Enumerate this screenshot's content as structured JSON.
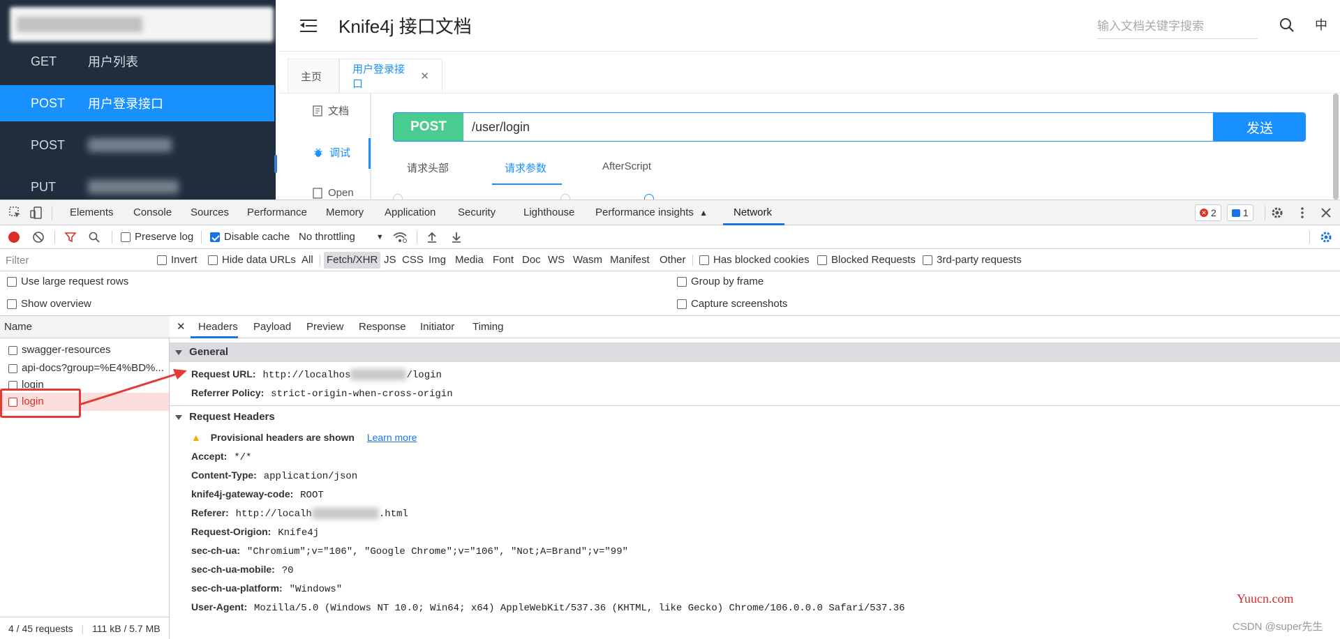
{
  "app": {
    "sidebar": {
      "items": [
        {
          "method": "GET",
          "label": "用户列表"
        },
        {
          "method": "POST",
          "label": "用户登录接口"
        },
        {
          "method": "POST",
          "label": ""
        },
        {
          "method": "PUT",
          "label": ""
        }
      ]
    },
    "header": {
      "title": "Knife4j 接口文档",
      "search_placeholder": "输入文档关键字搜索",
      "lang": "中"
    },
    "tabs": [
      {
        "label": "主页"
      },
      {
        "label": "用户登录接口"
      }
    ],
    "vnav": [
      {
        "label": "文档"
      },
      {
        "label": "调试"
      },
      {
        "label": "Open"
      }
    ],
    "request": {
      "method": "POST",
      "url": "/user/login",
      "send_label": "发送"
    },
    "req_tabs": [
      {
        "label": "请求头部"
      },
      {
        "label": "请求参数"
      },
      {
        "label": "AfterScript"
      }
    ]
  },
  "devtools": {
    "tabs": [
      "Elements",
      "Console",
      "Sources",
      "Performance",
      "Memory",
      "Application",
      "Security",
      "Lighthouse",
      "Performance insights",
      "Network"
    ],
    "active_tab": "Network",
    "error_count": "2",
    "message_count": "1",
    "toolbar": {
      "preserve_log": "Preserve log",
      "disable_cache": "Disable cache",
      "throttling": "No throttling"
    },
    "filter": {
      "placeholder": "Filter",
      "invert": "Invert",
      "hide_data_urls": "Hide data URLs",
      "types": [
        "All",
        "Fetch/XHR",
        "JS",
        "CSS",
        "Img",
        "Media",
        "Font",
        "Doc",
        "WS",
        "Wasm",
        "Manifest",
        "Other"
      ],
      "active_type": "Fetch/XHR",
      "has_blocked_cookies": "Has blocked cookies",
      "blocked_requests": "Blocked Requests",
      "third_party": "3rd-party requests"
    },
    "options": {
      "large_rows": "Use large request rows",
      "show_overview": "Show overview",
      "group_by_frame": "Group by frame",
      "capture_screenshots": "Capture screenshots"
    },
    "list": {
      "header": "Name",
      "rows": [
        "swagger-resources",
        "api-docs?group=%E4%BD%...",
        "login",
        "login"
      ],
      "selected_index": 3,
      "footer_requests": "4 / 45 requests",
      "footer_size": "111 kB / 5.7 MB"
    },
    "detail": {
      "tabs": [
        "Headers",
        "Payload",
        "Preview",
        "Response",
        "Initiator",
        "Timing"
      ],
      "active_tab": "Headers",
      "general": {
        "title": "General",
        "request_url_key": "Request URL:",
        "request_url_prefix": "http://localhos",
        "request_url_suffix": "/login",
        "referrer_policy_key": "Referrer Policy:",
        "referrer_policy": "strict-origin-when-cross-origin"
      },
      "request_headers": {
        "title": "Request Headers",
        "warning": "Provisional headers are shown",
        "learn_more": "Learn more",
        "rows": [
          {
            "k": "Accept:",
            "v": "*/*"
          },
          {
            "k": "Content-Type:",
            "v": "application/json"
          },
          {
            "k": "knife4j-gateway-code:",
            "v": "ROOT"
          },
          {
            "k": "Referer:",
            "v": "http://localh",
            "v2": ".html"
          },
          {
            "k": "Request-Origion:",
            "v": "Knife4j"
          },
          {
            "k": "sec-ch-ua:",
            "v": "\"Chromium\";v=\"106\", \"Google Chrome\";v=\"106\", \"Not;A=Brand\";v=\"99\""
          },
          {
            "k": "sec-ch-ua-mobile:",
            "v": "?0"
          },
          {
            "k": "sec-ch-ua-platform:",
            "v": "\"Windows\""
          },
          {
            "k": "User-Agent:",
            "v": "Mozilla/5.0 (Windows NT 10.0; Win64; x64) AppleWebKit/537.36 (KHTML, like Gecko) Chrome/106.0.0.0 Safari/537.36"
          }
        ]
      }
    }
  },
  "watermarks": {
    "site": "Yuucn.com",
    "csdn": "CSDN @super先生"
  },
  "colors": {
    "accent": "#1890ff",
    "post_method": "#49cc90",
    "sidebar_bg": "#1f2d3d",
    "annotation_red": "#e53935",
    "devtools_blue": "#1a73e8"
  }
}
